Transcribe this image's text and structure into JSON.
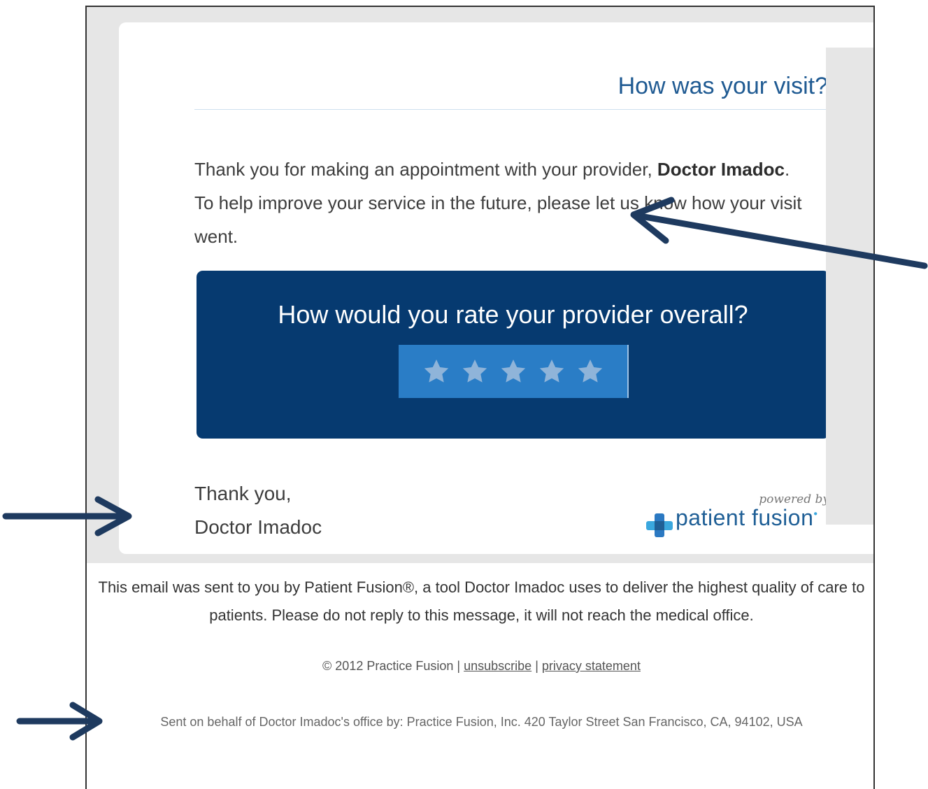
{
  "email": {
    "heading": "How was your visit?",
    "intro": {
      "part1": "Thank you for making an appointment with your provider, ",
      "provider": "Doctor Imadoc",
      "part2": ". To help improve your service in the future, please let us know how your visit went."
    },
    "rating": {
      "question": "How would you rate your provider overall?",
      "star_count": 5
    },
    "signoff": {
      "line1": "Thank you,",
      "line2": "Doctor Imadoc"
    },
    "branding": {
      "powered_by": "powered by",
      "logo_text": "patient fusion",
      "logo_mark": "•"
    }
  },
  "footer": {
    "note": "This email was sent to you by Patient Fusion®, a tool Doctor Imadoc uses to deliver the highest quality of care to patients. Please do not reply to this message, it will not reach the medical office.",
    "copyright": "© 2012 Practice Fusion",
    "separator": "|",
    "unsubscribe_label": "unsubscribe",
    "privacy_label": "privacy statement",
    "sender": "Sent on behalf of Doctor Imadoc's office by: Practice Fusion, Inc. 420 Taylor Street San Francisco, CA, 94102, USA"
  },
  "colors": {
    "heading": "#1f5a92",
    "rating_box": "#063a70",
    "stars_bar": "#2a7dc6",
    "star": "#8fb4d9",
    "annotation_arrow": "#1e3a5f"
  },
  "annotations": {
    "arrow_icon": "arrow-left-icon / arrow-right-icon",
    "count": 3
  }
}
